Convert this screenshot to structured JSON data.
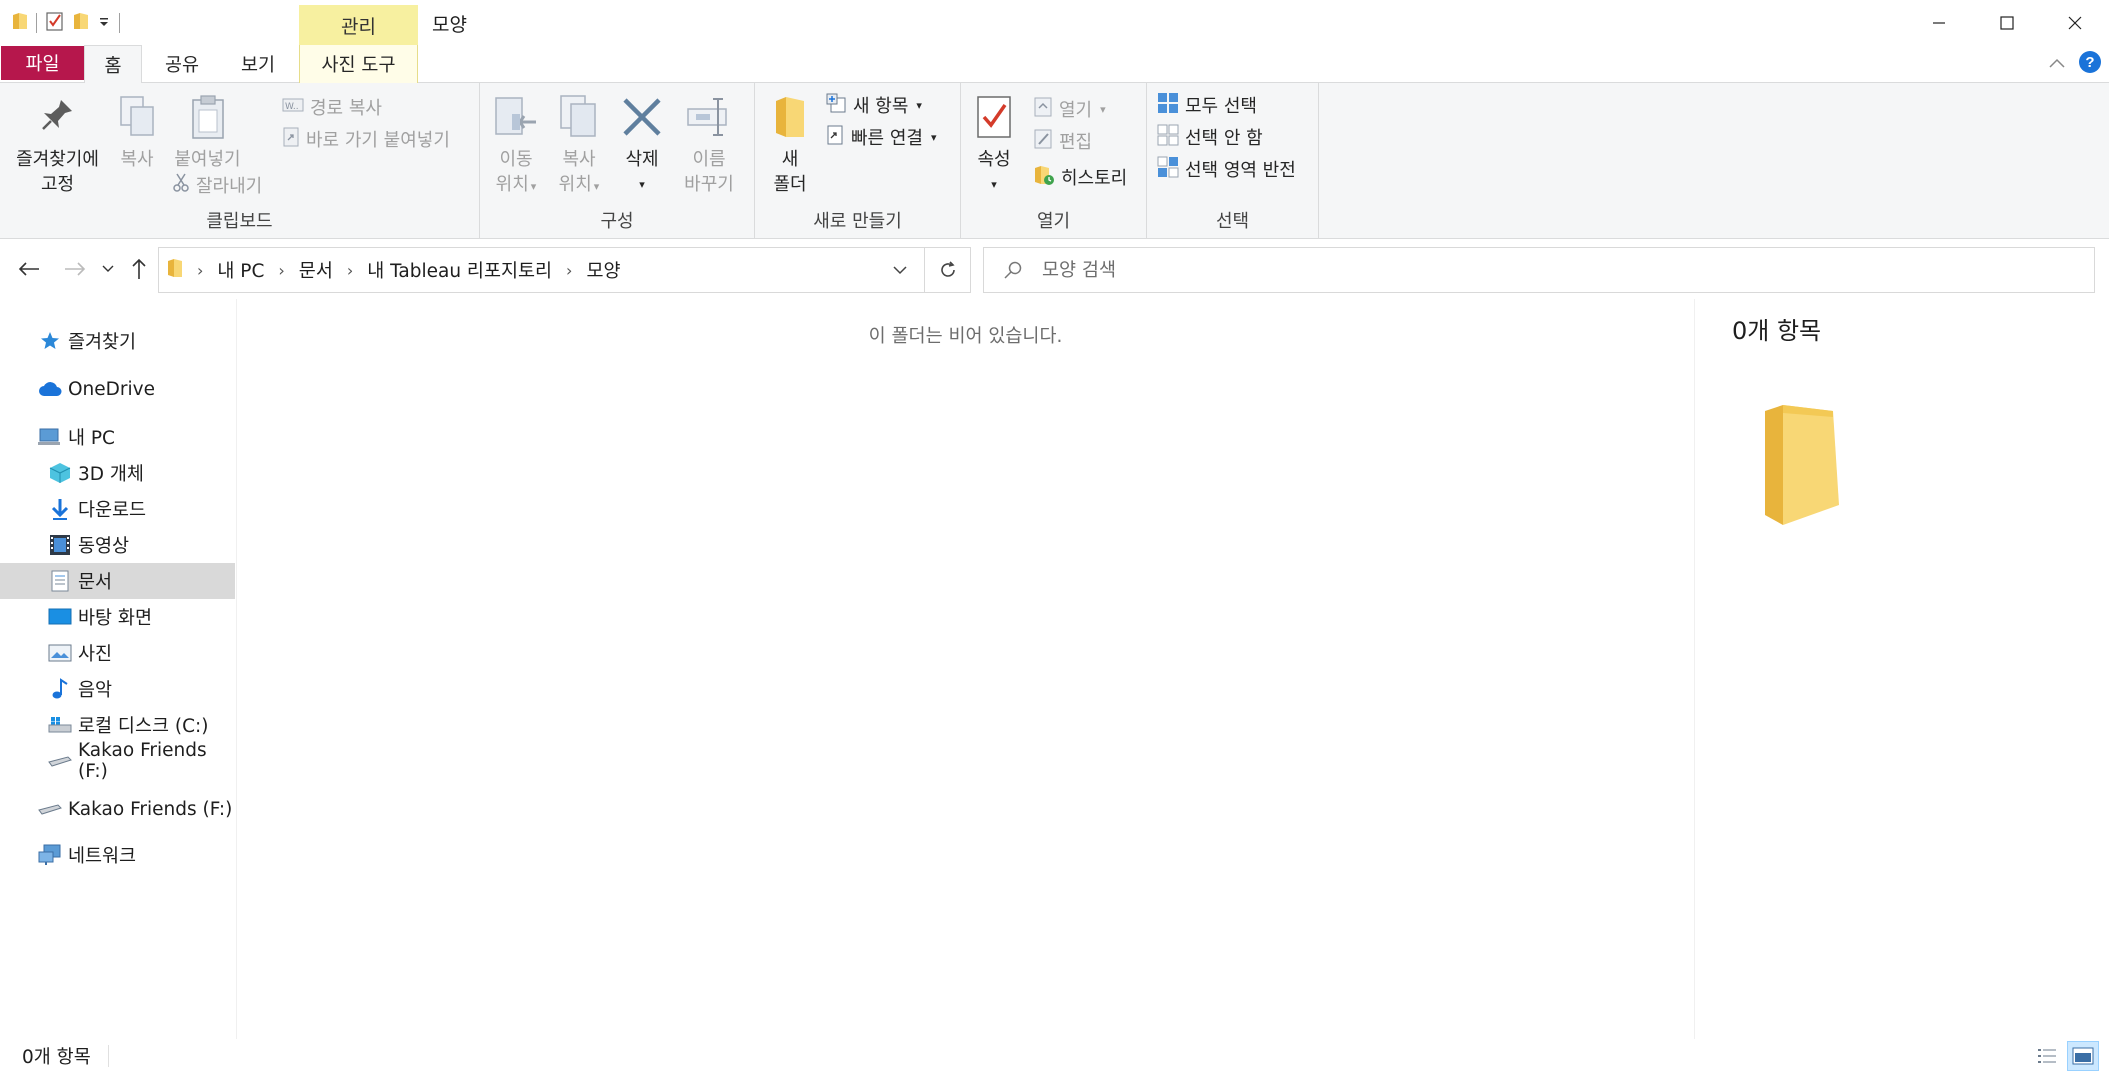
{
  "window": {
    "title": "모양",
    "context_tab_group": "관리",
    "minimize_label": "minimize",
    "maximize_label": "maximize",
    "close_label": "close"
  },
  "ribbon_tabs": {
    "file": "파일",
    "home": "홈",
    "share": "공유",
    "view": "보기",
    "photo_tools": "사진 도구"
  },
  "clipboard": {
    "pin": "즐겨찾기에\n고정",
    "pin_l1": "즐겨찾기에",
    "pin_l2": "고정",
    "copy": "복사",
    "paste": "붙여넣기",
    "copy_path": "경로 복사",
    "paste_shortcut": "바로 가기 붙여넣기",
    "cut": "잘라내기",
    "label": "클립보드"
  },
  "organize": {
    "move_l1": "이동",
    "move_l2": "위치",
    "copy_l1": "복사",
    "copy_l2": "위치",
    "delete": "삭제",
    "rename_l1": "이름",
    "rename_l2": "바꾸기",
    "label": "구성"
  },
  "new": {
    "folder_l1": "새",
    "folder_l2": "폴더",
    "new_item": "새 항목",
    "easy_access": "빠른 연결",
    "label": "새로 만들기"
  },
  "open": {
    "properties": "속성",
    "open": "열기",
    "edit": "편집",
    "history": "히스토리",
    "label": "열기"
  },
  "select": {
    "select_all": "모두 선택",
    "select_none": "선택 안 함",
    "invert": "선택 영역 반전",
    "label": "선택"
  },
  "address": {
    "crumbs": [
      "내 PC",
      "문서",
      "내 Tableau 리포지토리",
      "모양"
    ]
  },
  "search": {
    "placeholder": "모양 검색"
  },
  "nav": {
    "favorites": "즐겨찾기",
    "onedrive": "OneDrive",
    "this_pc": "내 PC",
    "objects3d": "3D 개체",
    "downloads": "다운로드",
    "videos": "동영상",
    "documents": "문서",
    "desktop": "바탕 화면",
    "pictures": "사진",
    "music": "음악",
    "local_disk": "로컬 디스크 (C:)",
    "kakao_sub": "Kakao Friends (F:)",
    "kakao": "Kakao Friends (F:)",
    "network": "네트워크"
  },
  "content": {
    "empty_message": "이 폴더는 비어 있습니다."
  },
  "preview": {
    "item_count": "0개 항목"
  },
  "status": {
    "item_count": "0개 항목"
  },
  "colors": {
    "file_tab": "#b6174c",
    "context_tab": "#f7f0a0",
    "selected_nav": "#d9d9d9",
    "accent": "#1a73d9"
  }
}
